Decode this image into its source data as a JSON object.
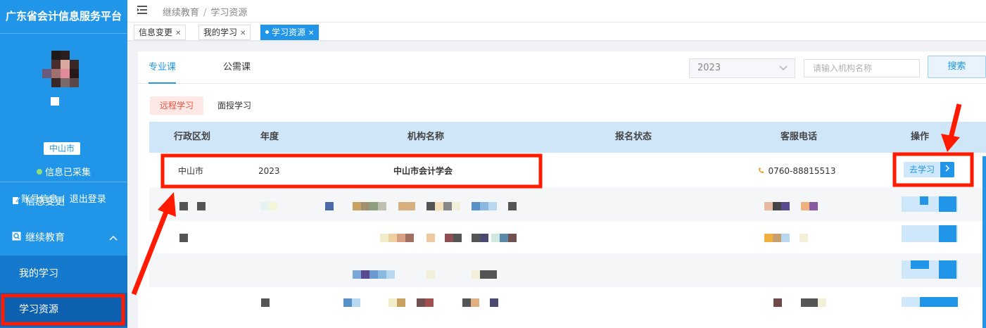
{
  "sidebar": {
    "brand": "广东省会计信息服务平台",
    "city": "中山市",
    "status": "信息已采集",
    "account_info": "账号信息",
    "separator": "|",
    "logout": "退出登录",
    "menu": [
      {
        "label": "信息变更",
        "icon": "edit-icon"
      },
      {
        "label": "继续教育",
        "icon": "search-icon",
        "expanded": true
      }
    ],
    "submenu": [
      {
        "label": "我的学习",
        "active": false
      },
      {
        "label": "学习资源",
        "active": true
      }
    ],
    "colors": {
      "bg": "#2196e8",
      "submenu_bg": "#1479cc",
      "active_bg": "#0d60b0"
    }
  },
  "topbar": {
    "breadcrumb": [
      "继续教育",
      "学习资源"
    ],
    "breadcrumb_sep": "/"
  },
  "tabs": [
    {
      "label": "信息变更",
      "active": false
    },
    {
      "label": "我的学习",
      "active": false
    },
    {
      "label": "学习资源",
      "active": true
    }
  ],
  "content": {
    "course_tabs": [
      {
        "label": "专业课",
        "active": true
      },
      {
        "label": "公需课",
        "active": false
      }
    ],
    "year": "2023",
    "search_placeholder": "请输入机构名称",
    "search_button": "搜索",
    "study_modes": [
      {
        "label": "远程学习",
        "active": true
      },
      {
        "label": "面授学习",
        "active": false
      }
    ],
    "table": {
      "headers": [
        "行政区划",
        "年度",
        "机构名称",
        "报名状态",
        "客服电话",
        "操作"
      ],
      "rows": [
        {
          "region": "中山市",
          "year": "2023",
          "org": "中山市会计学会",
          "status": "",
          "phone": "0760-88815513",
          "action": "去学习"
        }
      ]
    }
  },
  "colors": {
    "accent": "#2196e8",
    "annotation": "#ff1a00",
    "header_bg": "#cfe6f8"
  }
}
